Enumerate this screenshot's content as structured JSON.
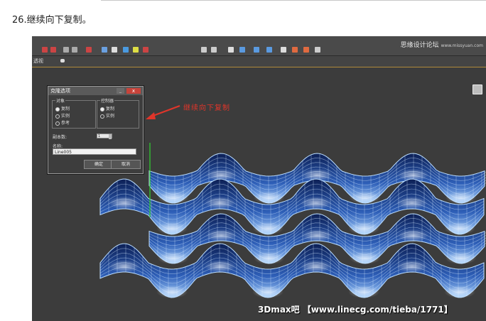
{
  "step_text": "26.继续向下复制。",
  "watermark_top": {
    "site": "思缘设计论坛",
    "url": "www.missyuan.com"
  },
  "subbar_label": "透视",
  "dialog": {
    "title": "克隆选项",
    "minimize": "_",
    "close": "x",
    "object_group": {
      "label": "对象",
      "options": [
        {
          "label": "复制",
          "selected": true
        },
        {
          "label": "实例",
          "selected": false
        },
        {
          "label": "参考",
          "selected": false
        }
      ]
    },
    "controller_group": {
      "label": "控制器",
      "options": [
        {
          "label": "复制",
          "selected": true
        },
        {
          "label": "实例",
          "selected": false
        }
      ]
    },
    "copies_label": "副本数:",
    "copies_value": "1",
    "name_label": "名称:",
    "name_value": "Line005",
    "ok_label": "确定",
    "cancel_label": "取消"
  },
  "annotation": "继续向下复制",
  "watermark_bottom": "3Dmax吧 【www.linecg.com/tieba/1771】",
  "colors": {
    "viewport": "#3c3c3c",
    "mesh_dark": "#0c1f55",
    "mesh_light": "#a8d2ff",
    "annotation": "#e0352a"
  }
}
